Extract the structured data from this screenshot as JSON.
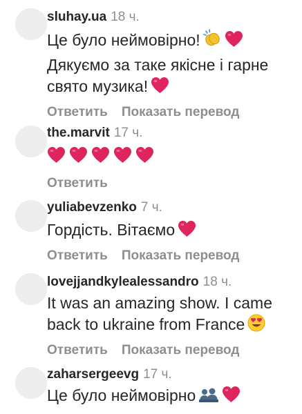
{
  "comments": [
    {
      "username": "sluhay.ua",
      "time": "18 ч.",
      "line1": "Це було неймовірно!",
      "line2": "Дякуємо за таке якісне і гарне свято музика!",
      "reply": "Ответить",
      "translate": "Показать перевод"
    },
    {
      "username": "the.marvit",
      "time": "17 ч.",
      "reply": "Ответить"
    },
    {
      "username": "yuliabevzenko",
      "time": "7 ч.",
      "line1": "Гордість. Вітаємо",
      "reply": "Ответить",
      "translate": "Показать перевод"
    },
    {
      "username": "lovejjandkylealessandro",
      "time": "18 ч.",
      "line1": "It was an amazing show. I came back to ukraine from France",
      "reply": "Ответить",
      "translate": "Показать перевод"
    },
    {
      "username": "zaharsergeevg",
      "time": "17 ч.",
      "line1": "Це було неймовірно"
    }
  ],
  "colors": {
    "username": "#262626",
    "secondary": "#8e8e8e",
    "heart": "#e0245e",
    "avatar": "#ededed"
  },
  "icons": [
    "clapping-hands-icon",
    "red-heart-icon",
    "heart-eyes-icon",
    "band-icon"
  ]
}
